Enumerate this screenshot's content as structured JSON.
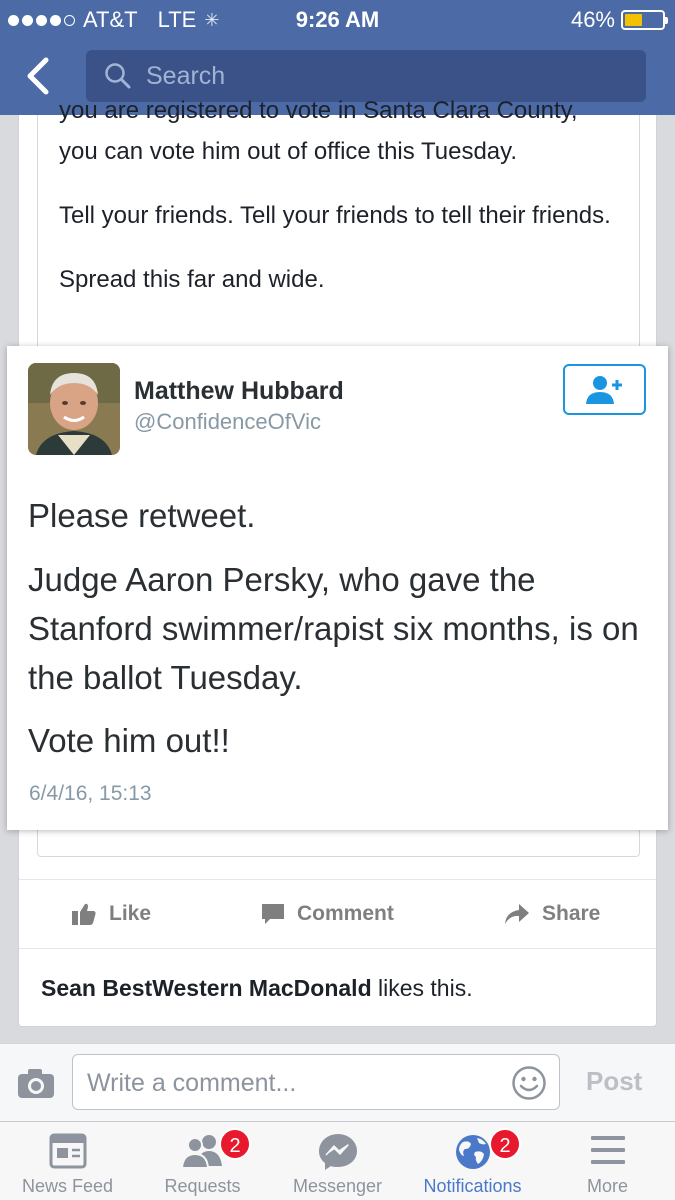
{
  "status_bar": {
    "carrier": "AT&T",
    "network": "LTE",
    "time": "9:26 AM",
    "battery": "46%",
    "battery_level": 0.46
  },
  "nav": {
    "search_placeholder": "Search"
  },
  "post": {
    "cut_line": "you are registered to vote in Santa Clara County,",
    "lines": [
      "you can vote him out of office this Tuesday.",
      "",
      "Tell your friends. Tell your friends to tell their friends.",
      "",
      "Spread this far and wide."
    ]
  },
  "tweet": {
    "name": "Matthew Hubbard",
    "handle": "@ConfidenceOfVic",
    "body": [
      "Please retweet.",
      "Judge Aaron Persky, who gave the Stanford swimmer/rapist six months, is on the ballot Tuesday.",
      "Vote him out!!"
    ],
    "date": "6/4/16, 15:13"
  },
  "actions": {
    "like": "Like",
    "comment": "Comment",
    "share": "Share"
  },
  "likes": {
    "name": "Sean BestWestern MacDonald",
    "suffix": " likes this."
  },
  "comment_bar": {
    "placeholder": "Write a comment...",
    "post_label": "Post"
  },
  "tabs": [
    {
      "label": "News Feed",
      "icon": "news-feed-icon",
      "badge": null
    },
    {
      "label": "Requests",
      "icon": "friend-requests-icon",
      "badge": "2"
    },
    {
      "label": "Messenger",
      "icon": "messenger-icon",
      "badge": null
    },
    {
      "label": "Notifications",
      "icon": "globe-icon",
      "badge": "2",
      "active": true
    },
    {
      "label": "More",
      "icon": "menu-icon",
      "badge": null
    }
  ],
  "colors": {
    "header": "#4c6aa6",
    "accent": "#4b78c8",
    "twitter_blue": "#1b95e0",
    "badge": "#e8192c"
  }
}
